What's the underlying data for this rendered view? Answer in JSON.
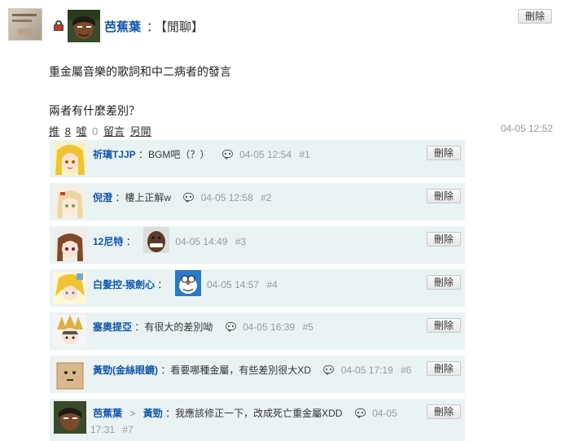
{
  "post": {
    "author": "芭蕉葉",
    "colon": "：",
    "category": "【閒聊】",
    "delete_label": "刪除",
    "body": [
      "重金屬音樂的歌詞和中二病者的發言",
      "",
      "兩者有什麼差別？"
    ],
    "stats": {
      "push_label": "推",
      "push_count": "8",
      "boo_label": "噓",
      "boo_count": "0",
      "comment_label": "留言",
      "other_label": "另開"
    },
    "time": "04-05 12:52"
  },
  "comments": [
    {
      "name": "祈璃TJJP",
      "content": "：BGM吧（？）",
      "time": "04-05 12:54",
      "floor": "#1",
      "avatar": "blonde-anime-girl",
      "delete_label": "刪除"
    },
    {
      "name": "倪澄",
      "content": "：樓上正解w",
      "time": "04-05 12:58",
      "floor": "#2",
      "avatar": "pale-anime-girl",
      "delete_label": "刪除"
    },
    {
      "name": "12尼特",
      "content": "：",
      "time": "04-05 14:49",
      "floor": "#3",
      "avatar": "brown-hair-anime",
      "sticker": "laughing-man-sticker",
      "delete_label": "刪除"
    },
    {
      "name": "白髮控-猴劍心",
      "content": "：",
      "time": "04-05 14:57",
      "floor": "#4",
      "avatar": "blonde-knight",
      "sticker": "doraemon-sticker",
      "delete_label": "刪除"
    },
    {
      "name": "塞奧提亞",
      "content": "：有很大的差別呦",
      "time": "04-05 16:39",
      "floor": "#5",
      "avatar": "horned-warrior",
      "delete_label": "刪除"
    },
    {
      "name": "黃勁(金絲眼鏡)",
      "content": "：看要哪種金屬，有些差別很大XD",
      "time": "04-05 17:19",
      "floor": "#6",
      "avatar": "paper-bag",
      "delete_label": "刪除"
    },
    {
      "name": "芭蕉葉",
      "reply_to": "黃勁",
      "reply_arrow": ">",
      "content": "：我應該修正一下，改成死亡重金屬XDD",
      "time_a": "04-05",
      "time_b": "17:31",
      "floor": "#7",
      "avatar": "dark-skin-man",
      "delete_label": "刪除"
    }
  ],
  "colors": {
    "name": "#1155aa",
    "comment_bg": "#e9f3f4",
    "muted": "#999999"
  }
}
